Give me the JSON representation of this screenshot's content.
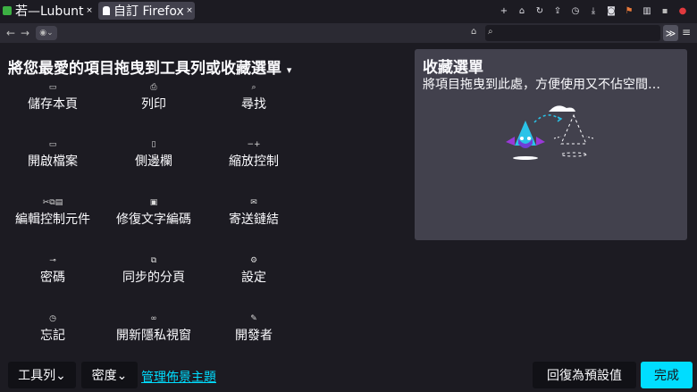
{
  "tabs": [
    {
      "title": "若—Lubunt",
      "close": "×"
    },
    {
      "title": "自訂 Firefox",
      "close": "×"
    }
  ],
  "toolbar_icons": [
    "plus-icon",
    "home-icon",
    "reload-icon",
    "upload-icon",
    "clock-icon",
    "download-icon",
    "screenshot-icon",
    "flag-icon",
    "ext-icon",
    "addon-icon",
    "red-icon"
  ],
  "nav": {
    "back": "←",
    "forward": "→",
    "identity": "◉⌄",
    "home": "⌂",
    "search": "⌕",
    "overflow": "≫",
    "menu": "≡"
  },
  "customize": {
    "heading": "將您最愛的項目拖曳到工具列或收藏選單",
    "items": [
      {
        "icon": "▭",
        "label": "儲存本頁"
      },
      {
        "icon": "⎙",
        "label": "列印"
      },
      {
        "icon": "⌕",
        "label": "尋找"
      },
      {
        "icon": "▭",
        "label": "開啟檔案"
      },
      {
        "icon": "▯",
        "label": "側邊欄"
      },
      {
        "icon": "−+",
        "label": "縮放控制"
      },
      {
        "icon": "✂⧉▤",
        "label": "編輯控制元件"
      },
      {
        "icon": "▣",
        "label": "修復文字編碼"
      },
      {
        "icon": "✉",
        "label": "寄送鏈結"
      },
      {
        "icon": "⊸",
        "label": "密碼"
      },
      {
        "icon": "⧉",
        "label": "同步的分頁"
      },
      {
        "icon": "⚙",
        "label": "設定"
      },
      {
        "icon": "◷",
        "label": "忘記"
      },
      {
        "icon": "∞",
        "label": "開新隱私視窗"
      },
      {
        "icon": "✎",
        "label": "開發者"
      }
    ]
  },
  "overflow_panel": {
    "title": "收藏選單",
    "description": "將項目拖曳到此處，方便使用又不佔空間…"
  },
  "footer": {
    "toolbars": "工具列⌄",
    "density": "密度⌄",
    "manage_themes": "管理佈景主題",
    "restore_defaults": "回復為預設值",
    "done": "完成"
  }
}
